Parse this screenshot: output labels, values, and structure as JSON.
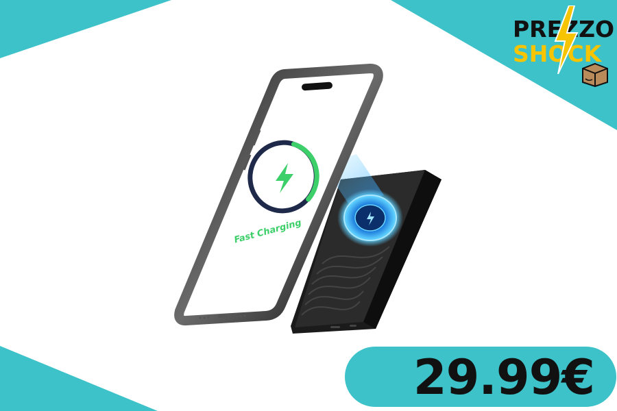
{
  "brand": {
    "line1": "PREZZO",
    "line2": "SHOCK",
    "icon": "amazon-box-icon"
  },
  "product": {
    "phone_screen_text": "Fast Charging",
    "icons": [
      "phone-frame",
      "lightning-bolt-icon",
      "magnetic-power-bank"
    ]
  },
  "price": {
    "label": "29.99€"
  },
  "colors": {
    "accent_teal": "#3cc2c8",
    "brand_yellow": "#f6c400",
    "charge_green": "#3ccf6a",
    "ring_navy": "#1f2a4a"
  }
}
